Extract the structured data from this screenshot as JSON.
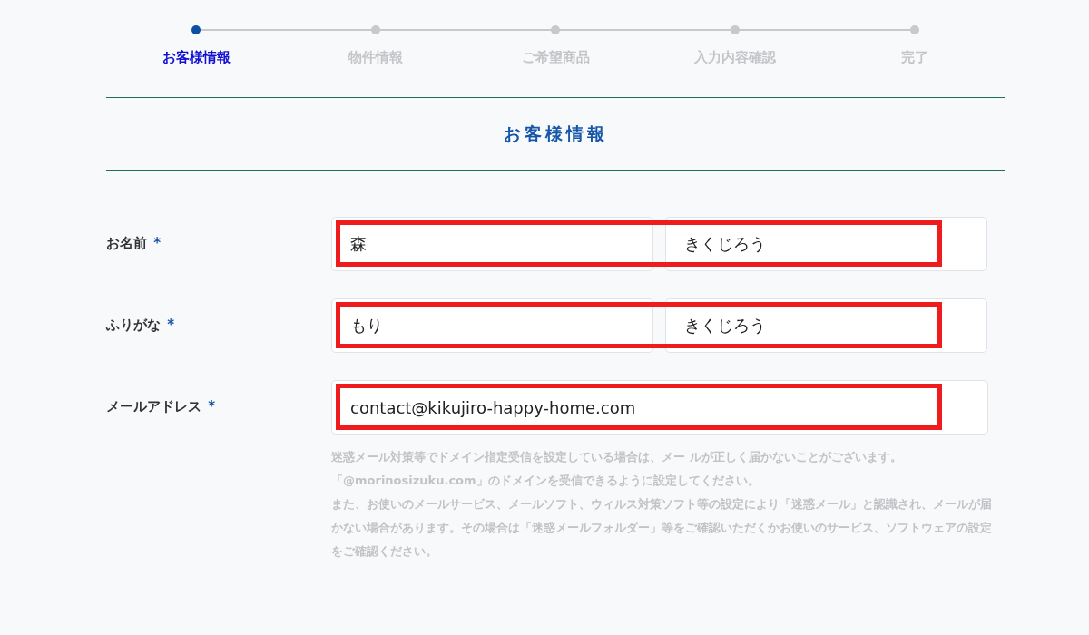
{
  "steps": [
    {
      "label": "お客様情報",
      "selected": true
    },
    {
      "label": "物件情報",
      "selected": false
    },
    {
      "label": "ご希望商品",
      "selected": false
    },
    {
      "label": "入力内容確認",
      "selected": false
    },
    {
      "label": "完了",
      "selected": false
    }
  ],
  "section_title": "お客様情報",
  "rows": [
    {
      "label": "お名前",
      "required_mark": "*",
      "highlighted": true,
      "fields": [
        {
          "value": "森"
        },
        {
          "value": "きくじろう"
        }
      ]
    },
    {
      "label": "ふりがな",
      "required_mark": "*",
      "highlighted": true,
      "fields": [
        {
          "value": "もり"
        },
        {
          "value": "きくじろう"
        }
      ]
    },
    {
      "label": "メールアドレス",
      "required_mark": "*",
      "highlighted": true,
      "fields": [
        {
          "value": "contact@kikujiro-happy-home.com"
        }
      ]
    }
  ],
  "note": [
    "迷惑メール対策等でドメイン指定受信を設定している場合は、メー ルが正しく届かないことがございます。",
    "「@morinosizuku.com」のドメインを受信できるように設定してください。",
    "また、お使いのメールサービス、メールソフト、ウィルス対策ソフト等の設定により「迷惑メール」と認識され、メールが届かない場合があります。その場合は「迷惑メールフォルダー」等をご確認いただくかお使いのサービス、ソフトウェアの設定をご確認ください。"
  ]
}
